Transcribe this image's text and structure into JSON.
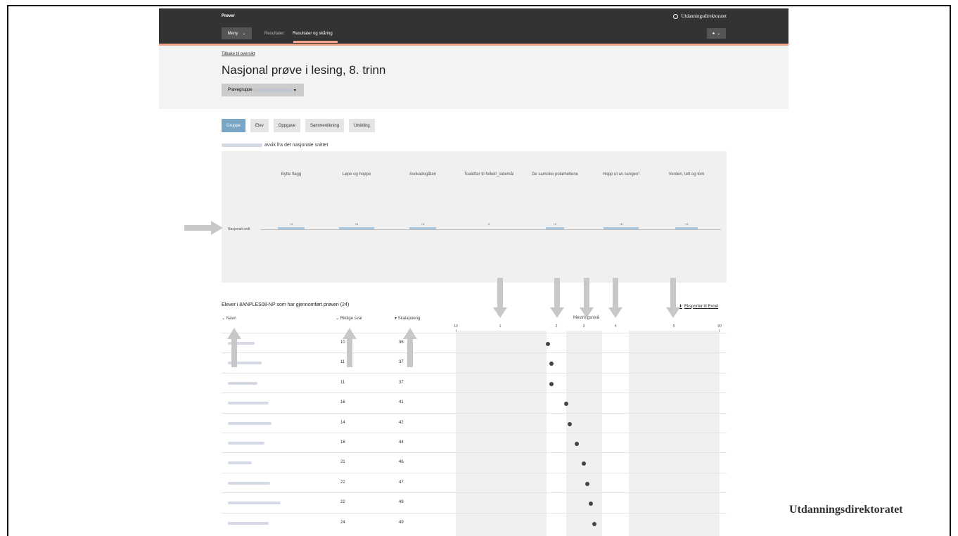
{
  "topbar": {
    "app_title": "Prøver",
    "brand": "Utdanningsdirektoratet",
    "menu_label": "Meny",
    "breadcrumb_label": "Resultater:",
    "breadcrumb_current": "Resultater og skåring"
  },
  "header": {
    "back_link": "Tilbake til oversikt",
    "title": "Nasjonal prøve i lesing, 8. trinn",
    "group_select_label": "Prøvegruppe"
  },
  "tabs": [
    {
      "label": "Gruppe",
      "active": true
    },
    {
      "label": "Elev",
      "active": false
    },
    {
      "label": "Oppgave",
      "active": false
    },
    {
      "label": "Sammenlikning",
      "active": false
    },
    {
      "label": "Utvikling",
      "active": false
    }
  ],
  "deviation_label": "avvik fra det nasjonale snittet",
  "chart_data": {
    "type": "bar",
    "categories": [
      "Bytte flagg",
      "Løpe og hoppe",
      "Avokadogåten",
      "Toaletter til folket!_sidemål",
      "De samiske polarheltene",
      "Hopp ut av sengen!",
      "Verden, tett og tom"
    ],
    "values": [
      4,
      6,
      4,
      0,
      2,
      6,
      3
    ],
    "value_labels": [
      "+4",
      "+6",
      "+4",
      "0",
      "+2",
      "+6",
      "+3"
    ],
    "baseline_label": "Nasjonalt snitt",
    "ylim": [
      0,
      10
    ]
  },
  "students": {
    "title": "Elever i 8ANPLES08-NP som har gjennomført prøven (24)",
    "export_label": "Eksporter til Excel",
    "columns": {
      "name": "Navn",
      "correct": "Riktige svar",
      "scale": "Skalapoeng",
      "mastery": "Mestringsnivå"
    },
    "rows": [
      {
        "correct": "10",
        "scale": "36"
      },
      {
        "correct": "11",
        "scale": "37"
      },
      {
        "correct": "11",
        "scale": "37"
      },
      {
        "correct": "16",
        "scale": "41"
      },
      {
        "correct": "14",
        "scale": "42"
      },
      {
        "correct": "18",
        "scale": "44"
      },
      {
        "correct": "21",
        "scale": "46"
      },
      {
        "correct": "22",
        "scale": "47"
      },
      {
        "correct": "22",
        "scale": "48"
      },
      {
        "correct": "24",
        "scale": "49"
      }
    ]
  },
  "mastery_scale": {
    "min_label": "10",
    "max_label": "90",
    "levels": [
      "1",
      "2",
      "3",
      "4",
      "5"
    ]
  },
  "footer_brand": "Utdanningsdirektoratet"
}
